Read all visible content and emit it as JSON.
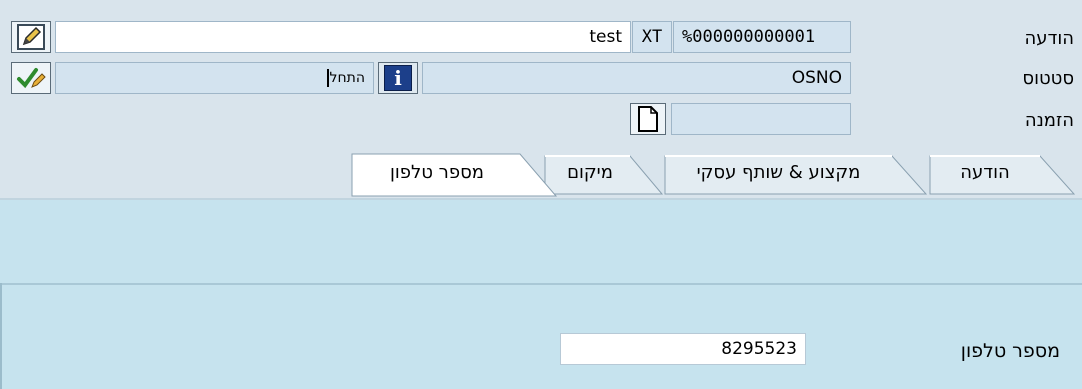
{
  "header": {
    "rows": [
      {
        "label": "הודעה",
        "field1": "%000000000001",
        "field2": "XT",
        "field3": "test"
      },
      {
        "label": "סטטוס",
        "field1": "OSNO",
        "field_left": "התחל"
      },
      {
        "label": "הזמנה",
        "field1": ""
      }
    ]
  },
  "tabs": [
    {
      "label": "הודעה",
      "active": false
    },
    {
      "label": "מקצוע & שותף עסקי",
      "active": false
    },
    {
      "label": "מיקום",
      "active": false
    },
    {
      "label": "מספר טלפון",
      "active": true
    }
  ],
  "form": {
    "phone_label": "מספר טלפון",
    "phone_value": "8295523"
  },
  "icons": {
    "edit": "edit-icon",
    "check": "check-pencil-icon",
    "info": "info-icon",
    "document": "document-icon"
  },
  "colors": {
    "background": "#d9e4ec",
    "panel": "#c6e3ee",
    "field": "#d3e3ef",
    "info_button": "#1c3f8a"
  }
}
